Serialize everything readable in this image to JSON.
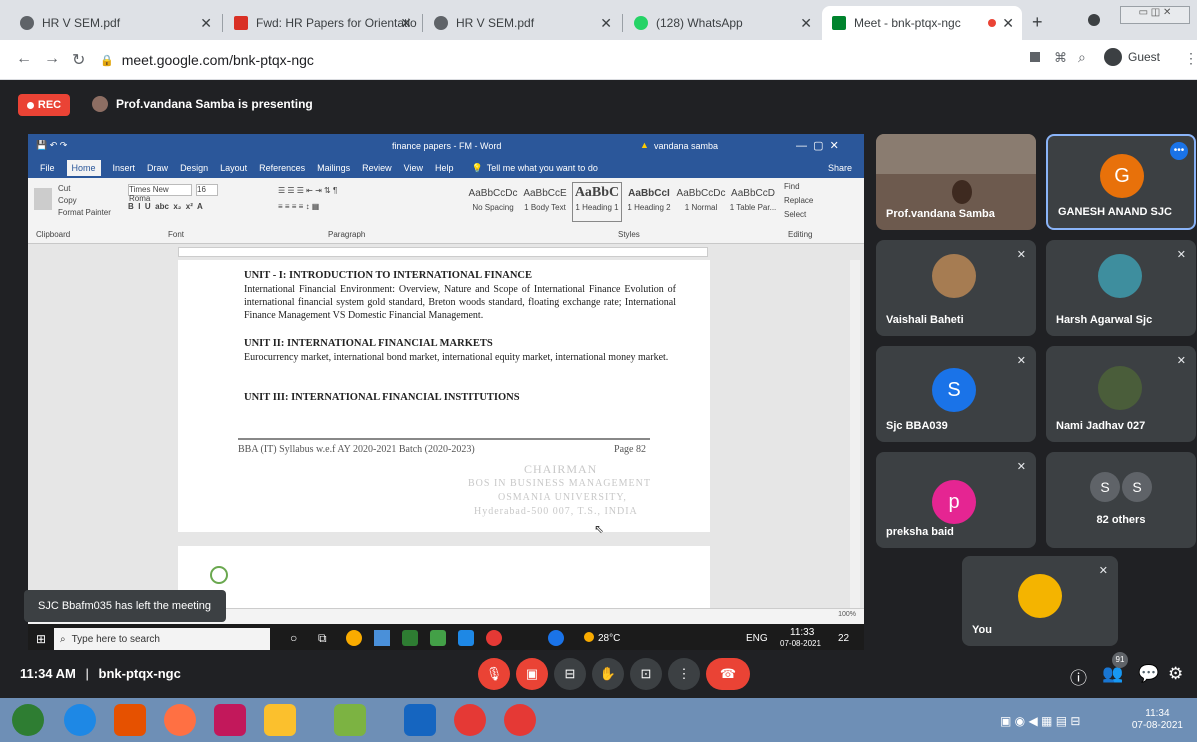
{
  "browser": {
    "tabs": [
      {
        "label": "HR V SEM.pdf",
        "favicon_color": "#5f6368"
      },
      {
        "label": "Fwd: HR Papers for Orientatio",
        "favicon_color": "#d93025"
      },
      {
        "label": "HR V SEM.pdf",
        "favicon_color": "#5f6368"
      },
      {
        "label": "(128) WhatsApp",
        "favicon_color": "#25d366"
      },
      {
        "label": "Meet - bnk-ptqx-ngc",
        "favicon_color": "#00832d"
      }
    ],
    "url": "meet.google.com/bnk-ptqx-ngc",
    "guest_label": "Guest"
  },
  "meet": {
    "rec_label": "REC",
    "presenting_text": "Prof.vandana Samba is presenting",
    "toast": "SJC Bbafm035 has left the meeting",
    "time": "11:34 AM",
    "meeting_code": "bnk-ptqx-ngc",
    "participants_badge": "91",
    "tiles": [
      {
        "name": "Prof.vandana Samba",
        "type": "video"
      },
      {
        "name": "GANESH ANAND SJC",
        "type": "avatar",
        "initial": "G",
        "color": "#e8710a"
      },
      {
        "name": "Vaishali Baheti",
        "type": "photo"
      },
      {
        "name": "Harsh Agarwal Sjc",
        "type": "photo"
      },
      {
        "name": "Sjc BBA039",
        "type": "avatar",
        "initial": "S",
        "color": "#1a73e8"
      },
      {
        "name": "Nami Jadhav 027",
        "type": "photo"
      },
      {
        "name": "preksha baid",
        "type": "avatar",
        "initial": "p",
        "color": "#e52592"
      },
      {
        "name": "82 others",
        "type": "others",
        "initials": [
          "S",
          "S"
        ]
      },
      {
        "name": "You",
        "type": "photo"
      }
    ]
  },
  "word": {
    "title": "finance papers - FM - Word",
    "user": "vandana samba",
    "tell_me": "Tell me what you want to do",
    "share": "Share",
    "menu": [
      "File",
      "Home",
      "Insert",
      "Draw",
      "Design",
      "Layout",
      "References",
      "Mailings",
      "Review",
      "View",
      "Help"
    ],
    "font_name": "Times New Roma",
    "font_size": "16",
    "ribbon_groups": [
      "Clipboard",
      "Font",
      "Paragraph",
      "Styles",
      "Editing"
    ],
    "clipboard": [
      "Cut",
      "Copy",
      "Format Painter"
    ],
    "styles": [
      {
        "preview": "AaBbCcDc",
        "label": "No Spacing"
      },
      {
        "preview": "AaBbCcE",
        "label": "1 Body Text"
      },
      {
        "preview": "AaBbC",
        "label": "1 Heading 1"
      },
      {
        "preview": "AaBbCcI",
        "label": "1 Heading 2"
      },
      {
        "preview": "AaBbCcDc",
        "label": "1 Normal"
      },
      {
        "preview": "AaBbCcD",
        "label": "1 Table Par..."
      }
    ],
    "editing": [
      "Find",
      "Replace",
      "Select"
    ],
    "doc": {
      "unit1_title": "UNIT - I: INTRODUCTION TO INTERNATIONAL FINANCE",
      "unit1_text": "International Financial Environment: Overview, Nature and Scope of International Finance Evolution of international financial system gold standard, Breton woods standard, floating exchange rate; International Finance Management VS Domestic Financial Management.",
      "unit2_title": "UNIT II: INTERNATIONAL FINANCIAL MARKETS",
      "unit2_text": "Eurocurrency market, international bond market, international equity market, international money market.",
      "unit3_title": "UNIT III: INTERNATIONAL FINANCIAL INSTITUTIONS",
      "footer_left": "BBA (IT) Syllabus w.e.f AY 2020-2021 Batch (2020-2023)",
      "footer_right": "Page 82",
      "stamp": [
        "CHAIRMAN",
        "BOS IN BUSINESS MANAGEMENT",
        "OSMANIA UNIVERSITY,",
        "Hyderabad-500 007, T.S., INDIA"
      ]
    },
    "zoom": "100%"
  },
  "taskbar": {
    "search_placeholder": "Type here to search",
    "weather": "28°C",
    "lang": "ENG",
    "time": "11:33",
    "date": "07-08-2021",
    "notif": "22"
  },
  "os": {
    "time": "11:34",
    "date": "07-08-2021"
  }
}
